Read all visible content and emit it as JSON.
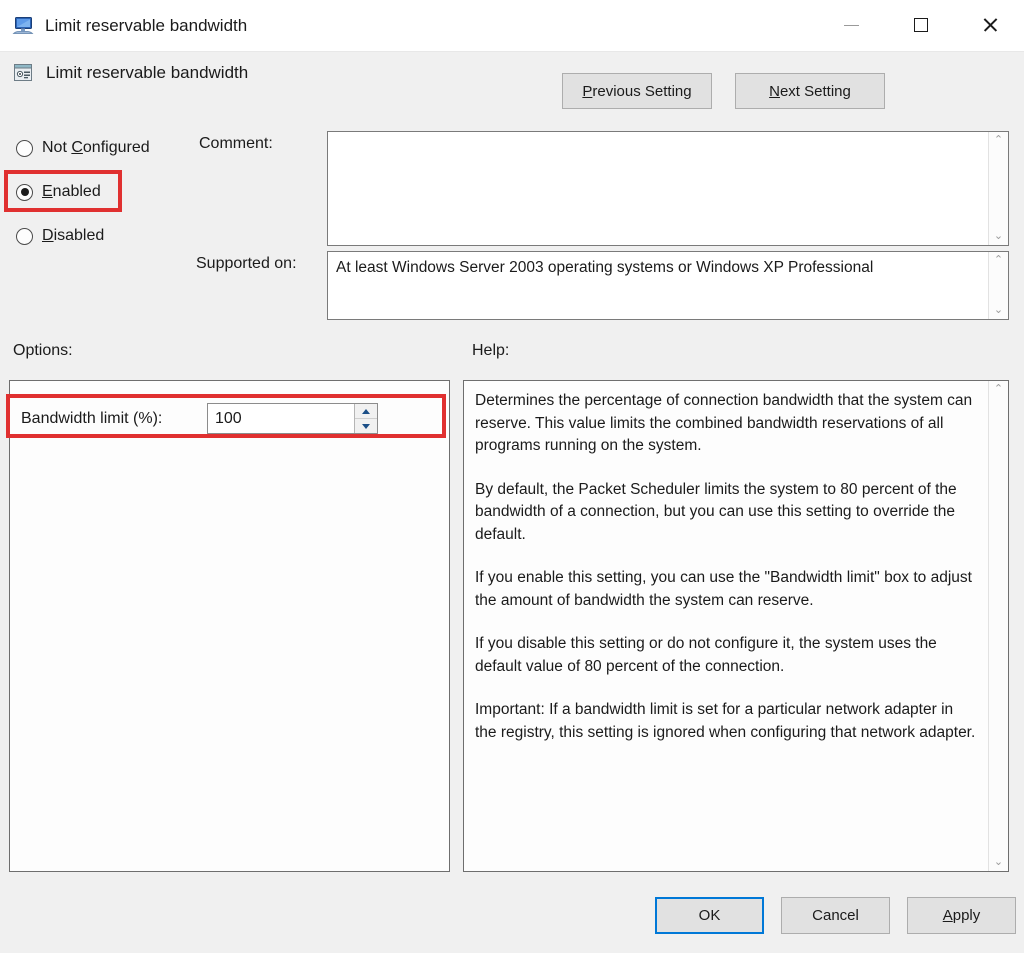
{
  "window": {
    "title": "Limit reservable bandwidth",
    "icon": "computer-icon",
    "controls": {
      "minimize": "minimize-icon",
      "maximize": "maximize-icon",
      "close": "close-icon"
    }
  },
  "header": {
    "setting_title": "Limit reservable bandwidth",
    "icon": "policy-setting-icon",
    "previous_setting_label_accel": "P",
    "previous_setting_label_rest": "revious Setting",
    "next_setting_label_accel": "N",
    "next_setting_label_rest": "ext Setting"
  },
  "state": {
    "selected": "Enabled",
    "options": [
      {
        "label_pre": "Not ",
        "accel": "C",
        "label_post": "onfigured",
        "checked": false,
        "name": "not-configured"
      },
      {
        "label_pre": "",
        "accel": "E",
        "label_post": "nabled",
        "checked": true,
        "name": "enabled"
      },
      {
        "label_pre": "",
        "accel": "D",
        "label_post": "isabled",
        "checked": false,
        "name": "disabled"
      }
    ]
  },
  "comment": {
    "label": "Comment:",
    "value": "",
    "placeholder": ""
  },
  "supported_on": {
    "label": "Supported on:",
    "value": "At least Windows Server 2003 operating systems or Windows XP Professional"
  },
  "options_panel": {
    "heading": "Options:",
    "bandwidth_label": "Bandwidth limit (%):",
    "bandwidth_value": "100",
    "spinner_up": "spinner-up-icon",
    "spinner_down": "spinner-down-icon"
  },
  "help_panel": {
    "heading": "Help:",
    "paragraphs": [
      "Determines the percentage of connection bandwidth that the system can reserve. This value limits the combined bandwidth reservations of all programs running on the system.",
      "By default, the Packet Scheduler limits the system to 80 percent of the bandwidth of a connection, but you can use this setting to override the default.",
      "If you enable this setting, you can use the \"Bandwidth limit\" box to adjust the amount of bandwidth the system can reserve.",
      "If you disable this setting or do not configure it, the system uses the default value of 80 percent of the connection.",
      "Important: If a bandwidth limit is set for a particular network adapter in the registry, this setting is ignored when configuring that network adapter."
    ]
  },
  "footer": {
    "ok_label": "OK",
    "cancel_label": "Cancel",
    "apply_label_accel": "A",
    "apply_label_rest": "pply"
  },
  "scrollbars": {
    "up_glyph": "⌃",
    "down_glyph": "⌄"
  },
  "annotations": {
    "highlight_color": "#e03030",
    "boxes": [
      "enabled-radio",
      "bandwidth-limit-row"
    ]
  }
}
